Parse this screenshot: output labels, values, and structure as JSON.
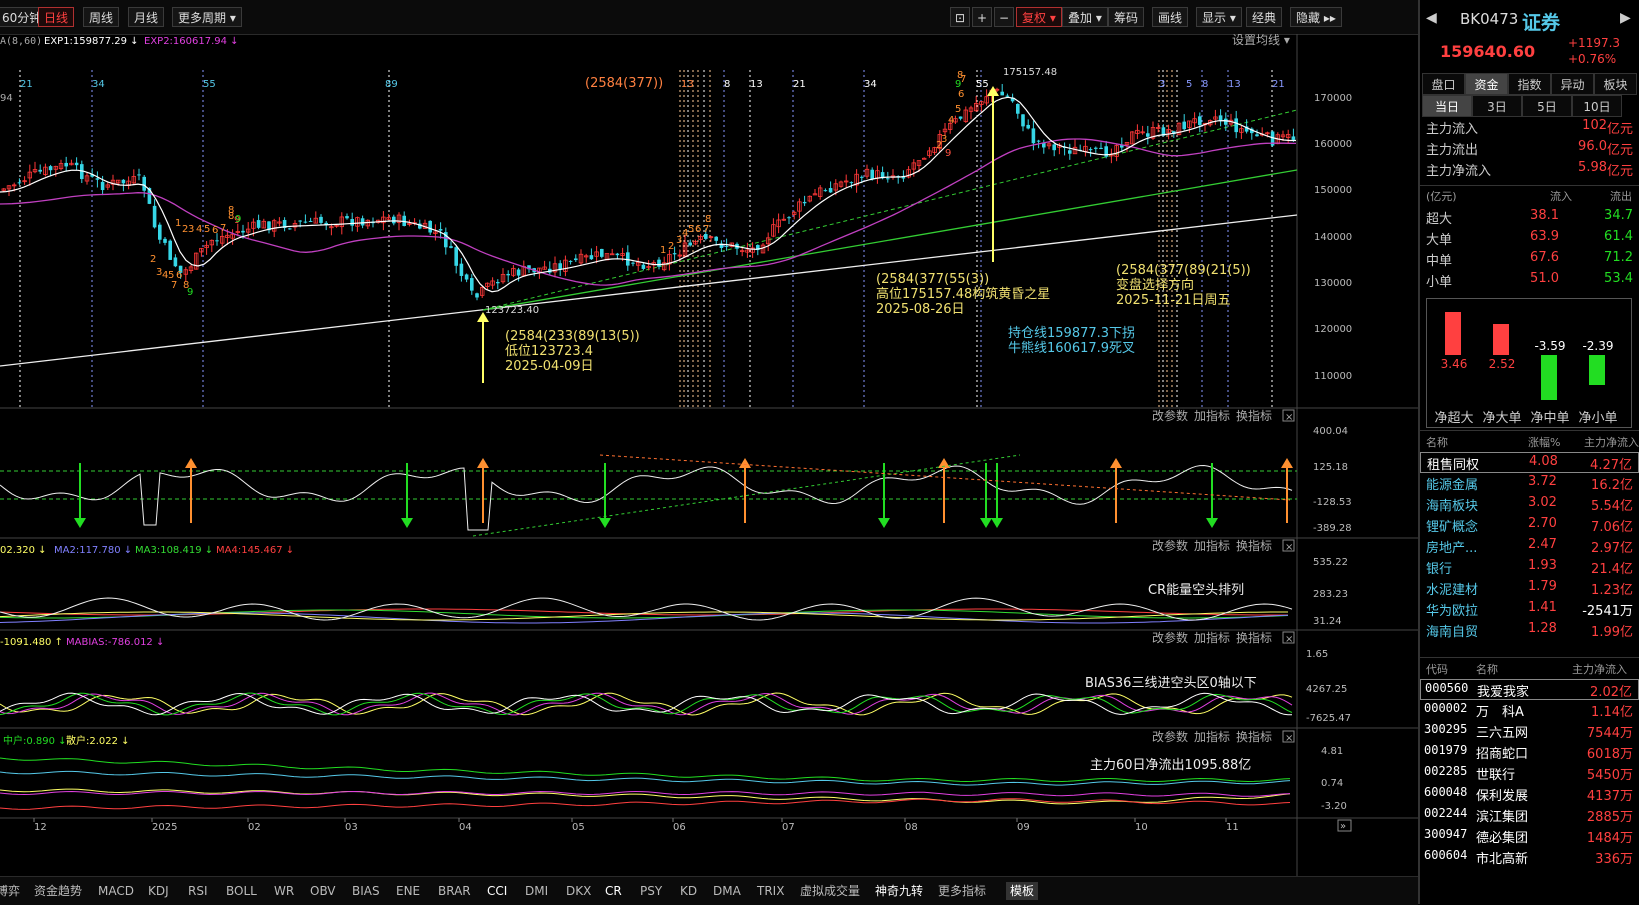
{
  "toolbar": {
    "items": [
      "60分钟",
      "日线",
      "周线",
      "月线",
      "更多周期 ▾"
    ],
    "right_items": [
      "复权 ▾",
      "叠加 ▾",
      "筹码",
      "画线",
      "显示 ▾",
      "经典",
      "隐藏 ▸▸"
    ],
    "icons": [
      "lock-icon",
      "plus-icon",
      "minus-icon"
    ]
  },
  "main_chart": {
    "ma_label": "A(8,60)",
    "exp1_label": "EXP1:159877.29 ↓",
    "exp2_label": "EXP2:160617.94 ↓",
    "ma_settings": "设置均线 ▾",
    "left_num": "94",
    "y_ticks": [
      "170000",
      "160000",
      "150000",
      "140000",
      "130000",
      "120000",
      "110000"
    ],
    "fib_top_labels": [
      "21",
      "34",
      "55",
      "89",
      "(2584(377))",
      "13",
      "8",
      "13",
      "21",
      "34",
      "9",
      "55",
      "3",
      "5",
      "8",
      "13",
      "21"
    ],
    "fib_counts_orange": [
      "8",
      "9",
      "1",
      "2",
      "3",
      "4",
      "5",
      "6",
      "7",
      "8",
      "9",
      "2",
      "3",
      "4",
      "5",
      "6",
      "7",
      "8",
      "9",
      "1",
      "2",
      "3",
      "4",
      "5",
      "6",
      "7",
      "8",
      "9",
      "2",
      "3",
      "4",
      "5",
      "6",
      "7",
      "8"
    ],
    "high_label": "175157.48",
    "low_label": "123723.40",
    "ann_low": [
      "(2584(233(89(13(5))",
      "低位123723.4",
      "2025-04-09日"
    ],
    "ann_high": [
      "(2584(377(55(3))",
      "高位175157.48构筑黄昏之星",
      "2025-08-26日"
    ],
    "ann_turn": [
      "(2584(377(89(21(5))",
      "变盘选择方向",
      "2025-11-21日周五"
    ],
    "ann_hold": [
      "持仓线159877.3下拐",
      "牛熊线160617.9死叉"
    ]
  },
  "panel_controls": [
    "改参数",
    "加指标",
    "换指标"
  ],
  "panel1": {
    "y_ticks": [
      "400.04",
      "125.18",
      "-128.53",
      "-389.28"
    ]
  },
  "panel2": {
    "legend": [
      "02.320 ↓",
      "MA2:117.780 ↓",
      "MA3:108.419 ↓",
      "MA4:145.467 ↓"
    ],
    "y_ticks": [
      "535.22",
      "283.23",
      "31.24"
    ],
    "note": "CR能量空头排列"
  },
  "panel3": {
    "legend": [
      "-1091.480 ↑",
      "MABIAS:-786.012 ↓"
    ],
    "y_ticks": [
      "1.65",
      "4267.25",
      "-7625.47"
    ],
    "note": "BIAS36三线进空头区0轴以下"
  },
  "panel4": {
    "legend": [
      "中户:0.890 ↓",
      "散户:2.022 ↓"
    ],
    "y_ticks": [
      "4.81",
      "0.74",
      "-3.20"
    ],
    "note": "主力60日净流出1095.88亿"
  },
  "x_axis": [
    "12",
    "2025",
    "02",
    "03",
    "04",
    "05",
    "06",
    "07",
    "08",
    "09",
    "10",
    "11"
  ],
  "bottom_tabs": [
    "博弈",
    "资金趋势",
    "MACD",
    "KDJ",
    "RSI",
    "BOLL",
    "WR",
    "OBV",
    "BIAS",
    "ENE",
    "BRAR",
    "CCI",
    "DMI",
    "DKX",
    "CR",
    "PSY",
    "KD",
    "DMA",
    "TRIX",
    "虚拟成交量",
    "神奇九转",
    "更多指标",
    "模板"
  ],
  "right": {
    "code": "BK0473",
    "name": "证券",
    "price": "159640.60",
    "change": "+1197.3",
    "pct": "+0.76%",
    "tabs1": [
      "盘口",
      "资金",
      "指数",
      "异动",
      "板块"
    ],
    "tabs2": [
      "当日",
      "3日",
      "5日",
      "10日"
    ],
    "flows": [
      {
        "label": "主力流入",
        "value": "102",
        "unit": "亿元"
      },
      {
        "label": "主力流出",
        "value": "96.0",
        "unit": "亿元"
      },
      {
        "label": "主力净流入",
        "value": "5.98",
        "unit": "亿元"
      }
    ],
    "table_head": [
      "(亿元)",
      "流入",
      "流出"
    ],
    "table": [
      {
        "k": "超大",
        "in": "38.1",
        "out": "34.7"
      },
      {
        "k": "大单",
        "in": "63.9",
        "out": "61.4"
      },
      {
        "k": "中单",
        "in": "67.6",
        "out": "71.2"
      },
      {
        "k": "小单",
        "in": "51.0",
        "out": "53.4"
      }
    ],
    "bars": [
      {
        "label": "净超大",
        "value": 3.46,
        "text": "3.46"
      },
      {
        "label": "净大单",
        "value": 2.52,
        "text": "2.52"
      },
      {
        "label": "净中单",
        "value": -3.59,
        "text": "-3.59"
      },
      {
        "label": "净小单",
        "value": -2.39,
        "text": "-2.39"
      }
    ],
    "sector_head": [
      "名称",
      "涨幅%",
      "主力净流入"
    ],
    "sectors": [
      {
        "n": "租售同权",
        "p": "4.08",
        "f": "4.27亿",
        "neg": false
      },
      {
        "n": "能源金属",
        "p": "3.72",
        "f": "16.2亿",
        "neg": false
      },
      {
        "n": "海南板块",
        "p": "3.02",
        "f": "5.54亿",
        "neg": false
      },
      {
        "n": "锂矿概念",
        "p": "2.70",
        "f": "7.06亿",
        "neg": false
      },
      {
        "n": "房地产...",
        "p": "2.47",
        "f": "2.97亿",
        "neg": false
      },
      {
        "n": "银行",
        "p": "1.93",
        "f": "21.4亿",
        "neg": false
      },
      {
        "n": "水泥建材",
        "p": "1.79",
        "f": "1.23亿",
        "neg": false
      },
      {
        "n": "华为欧拉",
        "p": "1.41",
        "f": "-2541万",
        "neg": true
      },
      {
        "n": "海南自贸",
        "p": "1.28",
        "f": "1.99亿",
        "neg": false
      }
    ],
    "stock_head": [
      "代码",
      "名称",
      "主力净流入"
    ],
    "stocks": [
      {
        "c": "000560",
        "n": "我爱我家",
        "f": "2.02亿"
      },
      {
        "c": "000002",
        "n": "万　科A",
        "f": "1.14亿"
      },
      {
        "c": "300295",
        "n": "三六五网",
        "f": "7544万"
      },
      {
        "c": "001979",
        "n": "招商蛇口",
        "f": "6018万"
      },
      {
        "c": "002285",
        "n": "世联行",
        "f": "5450万"
      },
      {
        "c": "600048",
        "n": "保利发展",
        "f": "4137万"
      },
      {
        "c": "002244",
        "n": "滨江集团",
        "f": "2885万"
      },
      {
        "c": "300947",
        "n": "德必集团",
        "f": "1484万"
      },
      {
        "c": "600604",
        "n": "市北高新",
        "f": "336万"
      }
    ]
  }
}
